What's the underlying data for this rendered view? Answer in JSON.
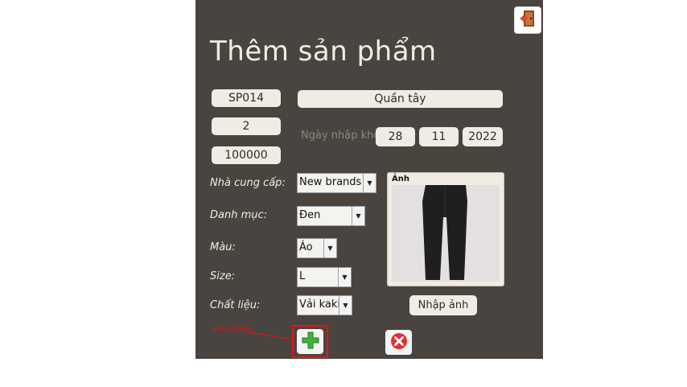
{
  "form": {
    "title": "Thêm sản phẩm",
    "product_id": "SP014",
    "product_name": "Quần tây",
    "quantity": "2",
    "price": "100000",
    "date_label": "Ngày nhập kho",
    "day": "28",
    "month": "11",
    "year": "2022"
  },
  "fields": {
    "supplier_label": "Nhà cung cấp:",
    "supplier_value": "New brands",
    "category_label": "Danh mục:",
    "category_value": "Đen",
    "color_label": "Màu:",
    "color_value": "Áo",
    "size_label": "Size:",
    "size_value": "L",
    "material_label": "Chất liệu:",
    "material_value": "Vải kaki"
  },
  "image_panel": {
    "label": "Ảnh",
    "import_button": "Nhập ảnh"
  },
  "actions": {
    "annotation": "Nhấn để thêm",
    "add_icon": "plus-icon",
    "cancel_icon": "x-icon",
    "exit_icon": "door-exit-icon"
  },
  "colors": {
    "panel_bg": "#4a4440",
    "pill_bg": "#f1ece3",
    "add_green": "#3cb43c",
    "cancel_red": "#e03030",
    "annotation_red": "#e11111"
  }
}
